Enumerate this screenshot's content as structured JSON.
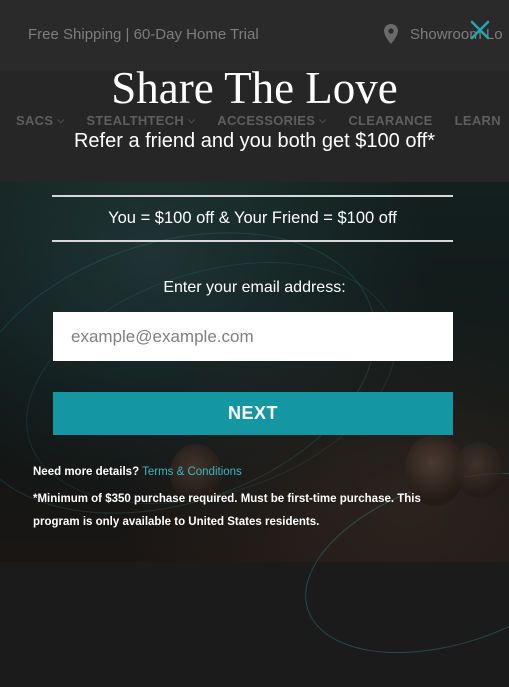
{
  "site": {
    "promo_text": "Free Shipping | 60-Day Home Trial",
    "showroom_label": "Showroom Lo",
    "nav": [
      {
        "label": "SACS"
      },
      {
        "label": "STEALTHTECH"
      },
      {
        "label": "ACCESSORIES"
      },
      {
        "label": "CLEARANCE"
      },
      {
        "label": "LEARN"
      }
    ],
    "colors": {
      "promo_bg": "#2a2a2a",
      "nav_bg": "#262626",
      "dim_text": "#7d7d7d"
    }
  },
  "modal": {
    "close_icon": "close-icon",
    "title": "Share The Love",
    "subtitle": "Refer a friend and you both get $100 off*",
    "offer": "You = $100 off & Your Friend = $100 off",
    "email_label": "Enter your email address:",
    "email_value": "",
    "email_placeholder": "example@example.com",
    "next_label": "NEXT",
    "details_prefix": "Need more details?",
    "terms_link": "Terms & Conditions",
    "fine_print": "*Minimum of $350 purchase required. Must be first-time purchase. This program is only available to United States residents.",
    "colors": {
      "accent": "#1497a3",
      "link": "#38b6c3",
      "text": "#ffffff"
    }
  }
}
